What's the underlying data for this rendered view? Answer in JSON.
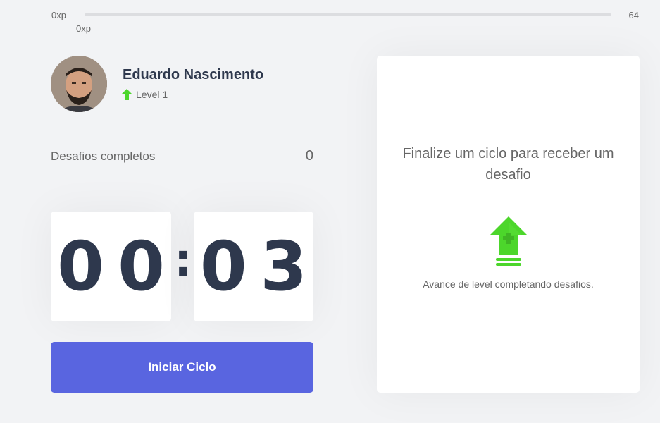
{
  "xp_bar": {
    "min_label": "0xp",
    "max_label": "64",
    "current_label": "0xp",
    "progress_percent": 0,
    "fill_color": "#4cd62b"
  },
  "profile": {
    "name": "Eduardo Nascimento",
    "level_label": "Level 1",
    "level_icon": "level-up-arrow-icon"
  },
  "completed_challenges": {
    "label": "Desafios completos",
    "value": "0"
  },
  "countdown": {
    "minute_left": "0",
    "minute_right": "0",
    "separator": ":",
    "second_left": "0",
    "second_right": "3"
  },
  "actions": {
    "start_label": "Iniciar Ciclo",
    "start_color": "#5965e0"
  },
  "challenge_box": {
    "title": "Finalize um ciclo para receber um desafio",
    "hint": "Avance de level completando desafios.",
    "icon": "level-up-icon",
    "accent_color": "#4cd62b"
  }
}
